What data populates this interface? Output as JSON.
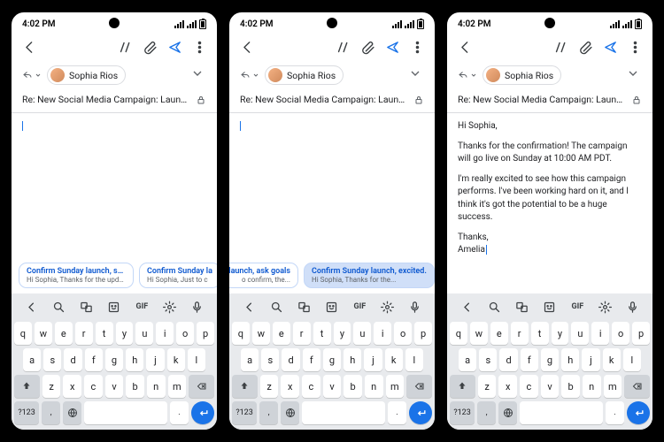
{
  "status": {
    "time": "4:02 PM"
  },
  "recipient": {
    "name": "Sophia Rios"
  },
  "subject": "Re: New Social Media Campaign: Launching N...",
  "screens": [
    {
      "body_segments": [],
      "show_cursor_only": true,
      "suggestions": [
        {
          "title": "Confirm Sunday launch, sugge...",
          "preview": "Hi Sophia, Thanks for the updat...",
          "active": false,
          "clip_left": false
        },
        {
          "title": "Confirm Sunday la",
          "preview": "Hi Sophia, Just to c",
          "active": false,
          "clip_left": false
        }
      ]
    },
    {
      "body_segments": [],
      "show_cursor_only": true,
      "suggestions": [
        {
          "title": "y launch, ask goals",
          "preview": "o confirm, the...",
          "active": false,
          "clip_left": true
        },
        {
          "title": "Confirm Sunday launch, excited.",
          "preview": "Hi Sophia, Thanks for the...",
          "active": true,
          "clip_left": false
        }
      ]
    },
    {
      "body_segments": [
        "Hi Sophia,",
        "Thanks for the confirmation! The campaign will go live on Sunday at 10:00 AM PDT.",
        "I'm really excited to see how this campaign performs. I've been working hard on it, and I think it's got the potential to be a huge success.",
        "Thanks,",
        "Amelia"
      ],
      "show_cursor_only": false,
      "suggestions": []
    }
  ],
  "keyboard": {
    "toolbar_gif": "GIF",
    "rows": [
      [
        "q",
        "w",
        "e",
        "r",
        "t",
        "y",
        "u",
        "i",
        "o",
        "p"
      ],
      [
        "a",
        "s",
        "d",
        "f",
        "g",
        "h",
        "j",
        "k",
        "l"
      ],
      [
        "z",
        "x",
        "c",
        "v",
        "b",
        "n",
        "m"
      ]
    ],
    "sym": "?123",
    "comma": ",",
    "period": "."
  }
}
